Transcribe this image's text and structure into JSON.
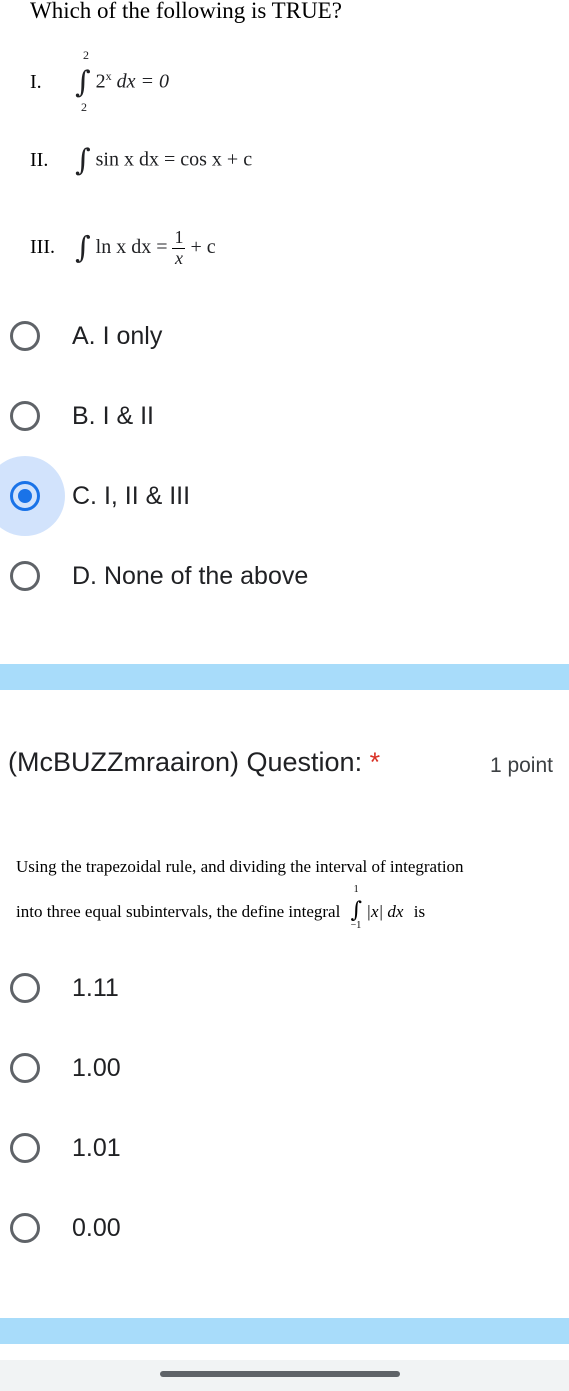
{
  "question1": {
    "prompt": "Which of the following is TRUE?",
    "statements": [
      {
        "roman": "I.",
        "integral_upper": "2",
        "integral_lower": "2",
        "expr": "2",
        "exp": "x",
        "rest": " dx = 0"
      },
      {
        "roman": "II.",
        "expr": "sin x dx = cos x + c"
      },
      {
        "roman": "III.",
        "expr_left": "ln x dx = ",
        "frac_num": "1",
        "frac_den": "x",
        "expr_right": " + c"
      }
    ],
    "options": [
      {
        "label": "A. I only",
        "selected": false
      },
      {
        "label": "B. I & II",
        "selected": false
      },
      {
        "label": "C. I, II & III",
        "selected": true
      },
      {
        "label": "D. None of the above",
        "selected": false
      }
    ]
  },
  "question2": {
    "title": "(McBUZZmraairon) Question:",
    "required_mark": "*",
    "points": "1 point",
    "body_line1": "Using the trapezoidal rule, and dividing the interval of integration",
    "body_line2_prefix": "into three equal subintervals, the define integral",
    "integral_upper": "1",
    "integral_lower": "−1",
    "integrand": "|x| dx",
    "body_suffix": "is",
    "options": [
      {
        "label": "1.11"
      },
      {
        "label": "1.00"
      },
      {
        "label": "1.01"
      },
      {
        "label": "0.00"
      }
    ]
  },
  "colors": {
    "accent": "#1a73e8",
    "band": "#a8dcfa",
    "required": "#d93025"
  }
}
